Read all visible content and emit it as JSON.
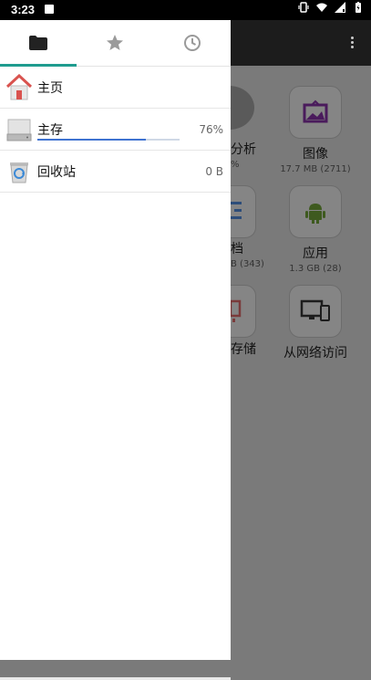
{
  "status_bar": {
    "time": "3:23"
  },
  "drawer": {
    "tabs": [
      {
        "name": "folder",
        "active": true
      },
      {
        "name": "favorites",
        "active": false
      },
      {
        "name": "recent",
        "active": false
      }
    ],
    "items": [
      {
        "label": "主页",
        "value": ""
      },
      {
        "label": "主存",
        "value": "76%",
        "progress": 0.76
      },
      {
        "label": "回收站",
        "value": "0 B"
      }
    ]
  },
  "background": {
    "tiles": [
      {
        "label": "图像",
        "sub": "17.7 MB (2711)"
      },
      {
        "label": "应用",
        "sub": "1.3 GB (28)"
      },
      {
        "label": "从网络访问",
        "sub": ""
      }
    ],
    "peek_texts": [
      "分析",
      "%",
      "档",
      "B (343)",
      "存储"
    ]
  },
  "colors": {
    "accent": "#1f9c8f",
    "progress": "#3f73d1",
    "scrim": "#7a7a7a"
  }
}
